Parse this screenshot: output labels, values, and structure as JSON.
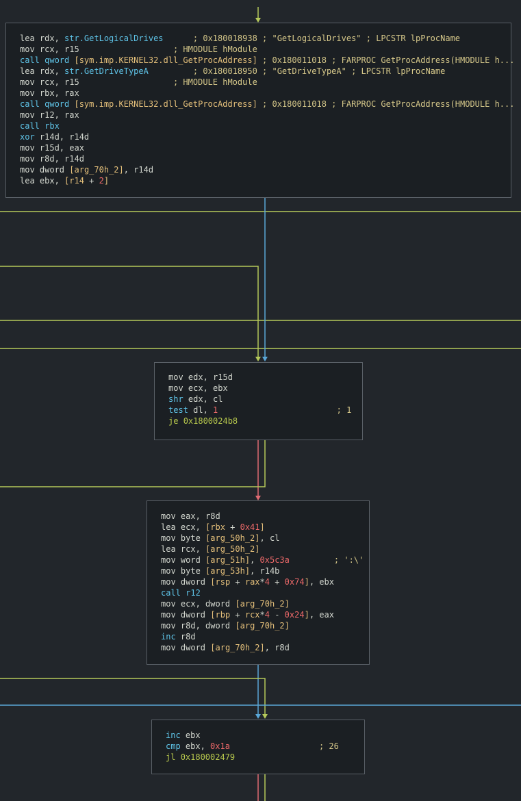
{
  "colors": {
    "background": "#22262b",
    "node_fill": "#1b1f23",
    "node_border": "#5a6067",
    "edge_unconditional": "#5aa7d8",
    "edge_true": "#b5c95a",
    "edge_false": "#e06a72"
  },
  "nodes": [
    {
      "id": "block-0",
      "lines": [
        [
          [
            "mn",
            "lea "
          ],
          [
            "rg",
            "rdx, "
          ],
          [
            "st",
            "str.GetLogicalDrives"
          ],
          [
            "tx",
            "      "
          ],
          [
            "cm",
            "; 0x180018938 ; \"GetLogicalDrives\" ; LPCSTR lpProcName"
          ]
        ],
        [
          [
            "mn",
            "mov "
          ],
          [
            "rg",
            "rcx, r15"
          ],
          [
            "tx",
            "                   "
          ],
          [
            "cm",
            "; HMODULE hModule"
          ]
        ],
        [
          [
            "cl",
            "call "
          ],
          [
            "cl",
            "qword "
          ],
          [
            "ar",
            "[sym.imp.KERNEL32.dll_GetProcAddress]"
          ],
          [
            "cm",
            " ; 0x180011018 ; FARPROC GetProcAddress(HMODULE h..."
          ]
        ],
        [
          [
            "mn",
            "lea "
          ],
          [
            "rg",
            "rdx, "
          ],
          [
            "st",
            "str.GetDriveTypeA"
          ],
          [
            "tx",
            "         "
          ],
          [
            "cm",
            "; 0x180018950 ; \"GetDriveTypeA\" ; LPCSTR lpProcName"
          ]
        ],
        [
          [
            "mn",
            "mov "
          ],
          [
            "rg",
            "rcx, r15"
          ],
          [
            "tx",
            "                   "
          ],
          [
            "cm",
            "; HMODULE hModule"
          ]
        ],
        [
          [
            "mn",
            "mov "
          ],
          [
            "rg",
            "rbx, rax"
          ]
        ],
        [
          [
            "cl",
            "call "
          ],
          [
            "cl",
            "qword "
          ],
          [
            "ar",
            "[sym.imp.KERNEL32.dll_GetProcAddress]"
          ],
          [
            "cm",
            " ; 0x180011018 ; FARPROC GetProcAddress(HMODULE h..."
          ]
        ],
        [
          [
            "mn",
            "mov "
          ],
          [
            "rg",
            "r12, rax"
          ]
        ],
        [
          [
            "cl",
            "call "
          ],
          [
            "cl",
            "rbx"
          ]
        ],
        [
          [
            "cl",
            "xor "
          ],
          [
            "rg",
            "r14d, r14d"
          ]
        ],
        [
          [
            "mn",
            "mov "
          ],
          [
            "rg",
            "r15d, eax"
          ]
        ],
        [
          [
            "mn",
            "mov "
          ],
          [
            "rg",
            "r8d, r14d"
          ]
        ],
        [
          [
            "mn",
            "mov "
          ],
          [
            "rg",
            "dword "
          ],
          [
            "ar",
            "[arg_70h_2]"
          ],
          [
            "rg",
            ", r14d"
          ]
        ],
        [
          [
            "mn",
            "lea "
          ],
          [
            "rg",
            "ebx, "
          ],
          [
            "ar",
            "[r14 "
          ],
          [
            "op",
            "+ "
          ],
          [
            "nm",
            "2"
          ],
          [
            "ar",
            "]"
          ]
        ]
      ]
    },
    {
      "id": "block-1",
      "lines": [
        [
          [
            "mn",
            "mov "
          ],
          [
            "rg",
            "edx, r15d"
          ]
        ],
        [
          [
            "mn",
            "mov "
          ],
          [
            "rg",
            "ecx, ebx"
          ]
        ],
        [
          [
            "cl",
            "shr "
          ],
          [
            "rg",
            "edx, cl"
          ]
        ],
        [
          [
            "cl",
            "test "
          ],
          [
            "rg",
            "dl, "
          ],
          [
            "nm",
            "1"
          ],
          [
            "tx",
            "                        "
          ],
          [
            "cm",
            "; 1"
          ]
        ],
        [
          [
            "jp",
            "je "
          ],
          [
            "jp",
            "0x1800024b8"
          ]
        ]
      ]
    },
    {
      "id": "block-2",
      "lines": [
        [
          [
            "mn",
            "mov "
          ],
          [
            "rg",
            "eax, r8d"
          ]
        ],
        [
          [
            "mn",
            "lea "
          ],
          [
            "rg",
            "ecx, "
          ],
          [
            "ar",
            "[rbx "
          ],
          [
            "op",
            "+ "
          ],
          [
            "nm",
            "0x41"
          ],
          [
            "ar",
            "]"
          ]
        ],
        [
          [
            "mn",
            "mov "
          ],
          [
            "rg",
            "byte "
          ],
          [
            "ar",
            "[arg_50h_2]"
          ],
          [
            "rg",
            ", cl"
          ]
        ],
        [
          [
            "mn",
            "lea "
          ],
          [
            "rg",
            "rcx, "
          ],
          [
            "ar",
            "[arg_50h_2]"
          ]
        ],
        [
          [
            "mn",
            "mov "
          ],
          [
            "rg",
            "word "
          ],
          [
            "ar",
            "[arg_51h]"
          ],
          [
            "rg",
            ", "
          ],
          [
            "nm",
            "0x5c3a"
          ],
          [
            "tx",
            "         "
          ],
          [
            "cm",
            "; ':\\'"
          ]
        ],
        [
          [
            "mn",
            "mov "
          ],
          [
            "rg",
            "byte "
          ],
          [
            "ar",
            "[arg_53h]"
          ],
          [
            "rg",
            ", r14b"
          ]
        ],
        [
          [
            "mn",
            "mov "
          ],
          [
            "rg",
            "dword "
          ],
          [
            "ar",
            "[rsp "
          ],
          [
            "op",
            "+ "
          ],
          [
            "ar",
            "rax"
          ],
          [
            "op",
            "*"
          ],
          [
            "nm",
            "4 "
          ],
          [
            "op",
            "+ "
          ],
          [
            "nm",
            "0x74"
          ],
          [
            "ar",
            "]"
          ],
          [
            "rg",
            ", ebx"
          ]
        ],
        [
          [
            "cl",
            "call "
          ],
          [
            "cl",
            "r12"
          ]
        ],
        [
          [
            "mn",
            "mov "
          ],
          [
            "rg",
            "ecx, dword "
          ],
          [
            "ar",
            "[arg_70h_2]"
          ]
        ],
        [
          [
            "mn",
            "mov "
          ],
          [
            "rg",
            "dword "
          ],
          [
            "ar",
            "[rbp "
          ],
          [
            "op",
            "+ "
          ],
          [
            "ar",
            "rcx"
          ],
          [
            "op",
            "*"
          ],
          [
            "nm",
            "4 "
          ],
          [
            "op",
            "- "
          ],
          [
            "nm",
            "0x24"
          ],
          [
            "ar",
            "]"
          ],
          [
            "rg",
            ", eax"
          ]
        ],
        [
          [
            "mn",
            "mov "
          ],
          [
            "rg",
            "r8d, dword "
          ],
          [
            "ar",
            "[arg_70h_2]"
          ]
        ],
        [
          [
            "cl",
            "inc "
          ],
          [
            "rg",
            "r8d"
          ]
        ],
        [
          [
            "mn",
            "mov "
          ],
          [
            "rg",
            "dword "
          ],
          [
            "ar",
            "[arg_70h_2]"
          ],
          [
            "rg",
            ", r8d"
          ]
        ]
      ]
    },
    {
      "id": "block-3",
      "lines": [
        [
          [
            "cl",
            "inc "
          ],
          [
            "rg",
            "ebx"
          ]
        ],
        [
          [
            "cl",
            "cmp "
          ],
          [
            "rg",
            "ebx, "
          ],
          [
            "nm",
            "0x1a"
          ],
          [
            "tx",
            "                  "
          ],
          [
            "cm",
            "; 26"
          ]
        ],
        [
          [
            "jp",
            "jl "
          ],
          [
            "jp",
            "0x180002479"
          ]
        ]
      ]
    }
  ]
}
